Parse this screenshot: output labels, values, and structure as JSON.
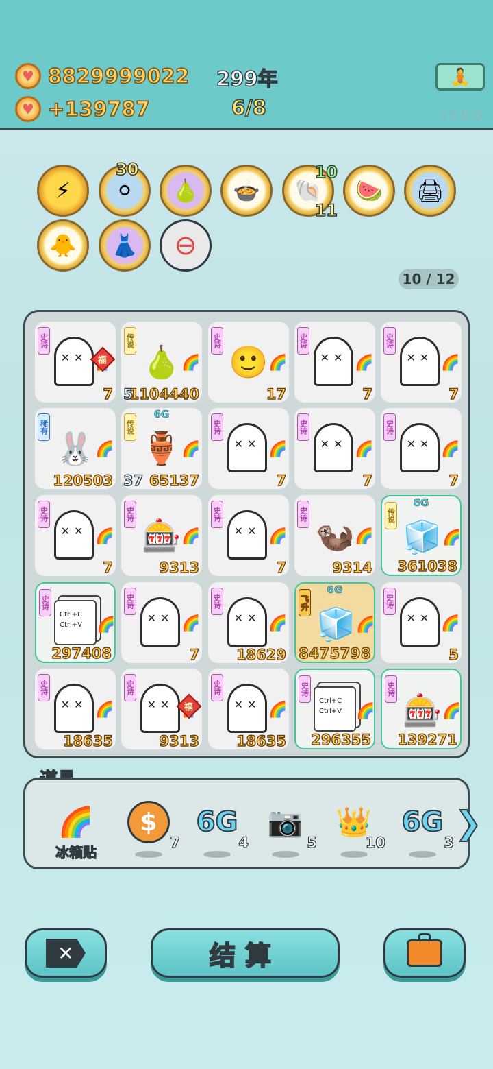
{
  "header": {
    "coins": "8829999022",
    "income": "+139787",
    "years": "299年",
    "round": "6/8",
    "version": "v3.8.0",
    "meditate_icon": "meditate-icon"
  },
  "relics": [
    {
      "icon": "⚡",
      "badge_top": "",
      "badge_bottom": ""
    },
    {
      "icon": "⚪",
      "badge_top": "30",
      "badge_bottom": ""
    },
    {
      "icon": "🍐",
      "badge_top": "",
      "badge_bottom": ""
    },
    {
      "icon": "🍲",
      "badge_top": "",
      "badge_bottom": ""
    },
    {
      "icon": "🐚",
      "badge_top": "10",
      "badge_bottom": "11"
    },
    {
      "icon": "🍉",
      "badge_top": "",
      "badge_bottom": ""
    },
    {
      "icon": "🖨",
      "badge_top": "",
      "badge_bottom": ""
    },
    {
      "icon": "🐥",
      "badge_top": "",
      "badge_bottom": ""
    },
    {
      "icon": "👗",
      "badge_top": "",
      "badge_bottom": ""
    },
    {
      "icon": "⊖",
      "badge_top": "",
      "badge_bottom": ""
    }
  ],
  "page_counter": "10 / 12",
  "board": {
    "cells": [
      {
        "tag": "史诗",
        "kind": "ghost",
        "fu": true,
        "value": "7",
        "left": ""
      },
      {
        "tag": "传说",
        "kind": "pear",
        "value": "1104440",
        "left": "5"
      },
      {
        "tag": "史诗",
        "kind": "face",
        "value": "17",
        "left": ""
      },
      {
        "tag": "史诗",
        "kind": "ghost",
        "value": "7",
        "left": ""
      },
      {
        "tag": "史诗",
        "kind": "ghost",
        "value": "7",
        "left": ""
      },
      {
        "tag": "稀有",
        "kind": "rabbit",
        "value": "120503",
        "left": ""
      },
      {
        "tag": "传说",
        "kind": "vase",
        "g6": "6G",
        "value": "65137",
        "left": "37"
      },
      {
        "tag": "史诗",
        "kind": "ghost",
        "value": "7",
        "left": ""
      },
      {
        "tag": "史诗",
        "kind": "ghost",
        "value": "7",
        "left": ""
      },
      {
        "tag": "史诗",
        "kind": "ghost",
        "value": "7",
        "left": ""
      },
      {
        "tag": "史诗",
        "kind": "ghost",
        "value": "7",
        "left": ""
      },
      {
        "tag": "史诗",
        "kind": "capsule",
        "value": "9313",
        "left": ""
      },
      {
        "tag": "史诗",
        "kind": "ghost",
        "value": "7",
        "left": ""
      },
      {
        "tag": "史诗",
        "kind": "otter",
        "value": "9314",
        "left": ""
      },
      {
        "tag": "传说",
        "kind": "fridge",
        "g6": "6G",
        "value": "361038",
        "left": ""
      },
      {
        "tag": "史诗",
        "kind": "ctrl",
        "value": "297408",
        "left": ""
      },
      {
        "tag": "史诗",
        "kind": "ghost",
        "value": "7",
        "left": ""
      },
      {
        "tag": "史诗",
        "kind": "ghost",
        "value": "18629",
        "left": ""
      },
      {
        "tag": "飞升",
        "kind": "fridge",
        "g6": "6G",
        "value": "8475798",
        "left": ""
      },
      {
        "tag": "史诗",
        "kind": "ghost",
        "value": "5",
        "left": ""
      },
      {
        "tag": "史诗",
        "kind": "ghost",
        "value": "18635",
        "left": ""
      },
      {
        "tag": "史诗",
        "kind": "ghost",
        "fu": true,
        "value": "9313",
        "left": ""
      },
      {
        "tag": "史诗",
        "kind": "ghost",
        "value": "18635",
        "left": ""
      },
      {
        "tag": "史诗",
        "kind": "ctrl",
        "value": "296355",
        "left": ""
      },
      {
        "tag": "史诗",
        "kind": "capsule",
        "value": "139271",
        "left": ""
      }
    ],
    "ctrl_c": "Ctrl+C",
    "ctrl_v": "Ctrl+V",
    "fu_char": "福"
  },
  "props": {
    "title": "道具",
    "items": [
      {
        "icon": "🌈",
        "label": "冰箱贴",
        "count": ""
      },
      {
        "icon": "$",
        "label": "",
        "count": "7"
      },
      {
        "icon": "6G",
        "label": "",
        "count": "4"
      },
      {
        "icon": "📷",
        "label": "",
        "count": "5"
      },
      {
        "icon": "👑",
        "label": "",
        "count": "10"
      },
      {
        "icon": "6G",
        "label": "",
        "count": "3"
      }
    ]
  },
  "buttons": {
    "settle": "结算",
    "cancel_icon": "close-icon",
    "bag_icon": "briefcase-icon"
  }
}
